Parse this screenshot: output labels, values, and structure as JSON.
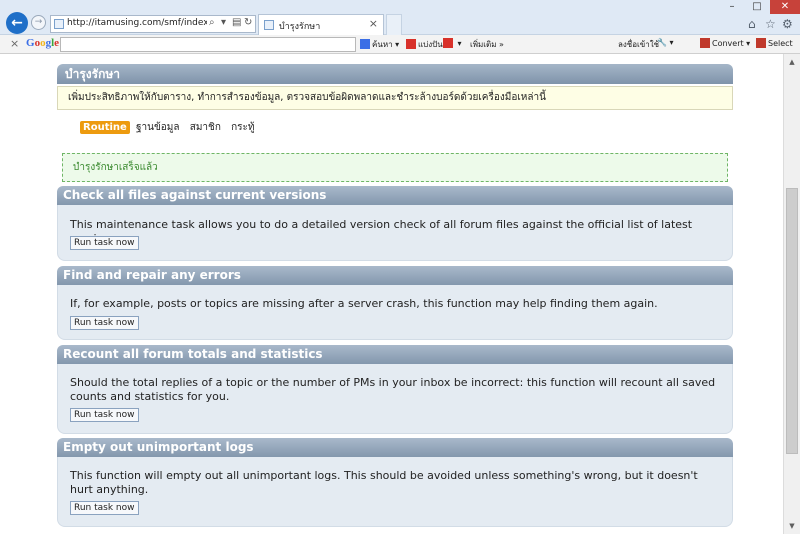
{
  "browser": {
    "url": "http://itamusing.com/smf/index.php?actior",
    "tab_title": "บำรุงรักษา",
    "tab_close": "×",
    "address_buttons": [
      "⌕",
      "▾",
      "▤",
      "↻"
    ],
    "window_controls": [
      "–",
      "□",
      "✕"
    ],
    "right_icons": [
      "home-icon",
      "star-icon",
      "gear-icon"
    ]
  },
  "google_toolbar": {
    "close": "×",
    "logo_letters": [
      "G",
      "o",
      "o",
      "g",
      "l",
      "e"
    ],
    "search_value": "",
    "buttons": [
      "ค้นหา",
      "แบ่งปัน",
      "",
      "เพิ่มเติม »"
    ],
    "signin": "ลงชื่อเข้าใช้",
    "convert": "Convert",
    "select": "Select"
  },
  "page": {
    "category_title": "บำรุงรักษา",
    "description": "เพิ่มประสิทธิภาพให้กับตาราง, ทำการสำรองข้อมูล, ตรวจสอบข้อผิดพลาดและชำระล้างบอร์ดด้วยเครื่องมือเหล่านี้",
    "submenu": {
      "active": "Routine",
      "items": [
        "ฐานข้อมูล",
        "สมาชิก",
        "กระทู้"
      ]
    },
    "success_message": "บำรุงรักษาเสร็จแล้ว",
    "run_label": "Run task now",
    "tasks": [
      {
        "title": "Check all files against current versions",
        "description": "This maintenance task allows you to do a detailed version check of all forum files against the official list of latest versions."
      },
      {
        "title": "Find and repair any errors",
        "description": "If, for example, posts or topics are missing after a server crash, this function may help finding them again."
      },
      {
        "title": "Recount all forum totals and statistics",
        "description": "Should the total replies of a topic or the number of PMs in your inbox be incorrect: this function will recount all saved counts and statistics for you."
      },
      {
        "title": "Empty out unimportant logs",
        "description": "This function will empty out all unimportant logs. This should be avoided unless something's wrong, but it doesn't hurt anything."
      }
    ]
  }
}
